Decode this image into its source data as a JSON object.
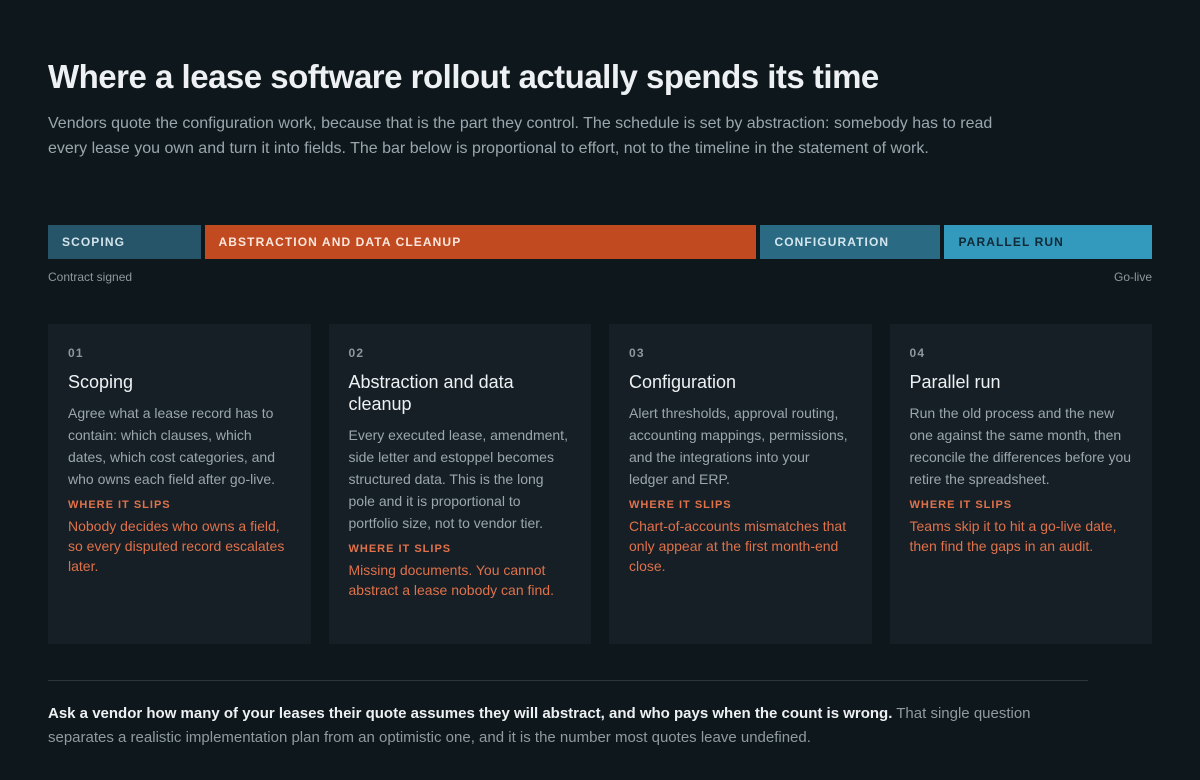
{
  "header": {
    "title": "Where a lease software rollout actually spends its time",
    "intro": "Vendors quote the configuration work, because that is the part they control. The schedule is set by abstraction: somebody has to read every lease you own and turn it into fields. The bar below is proportional to effort, not to the timeline in the statement of work."
  },
  "timeline": {
    "phases": [
      {
        "label": "SCOPING",
        "effort": 146,
        "bg": "#265468",
        "fg": "#d4e4ec"
      },
      {
        "label": "ABSTRACTION AND DATA CLEANUP",
        "effort": 567,
        "bg": "#c24a21",
        "fg": "#fbe7dd"
      },
      {
        "label": "CONFIGURATION",
        "effort": 175,
        "bg": "#2a6a82",
        "fg": "#d4e6ee"
      },
      {
        "label": "PARALLEL RUN",
        "effort": 204,
        "bg": "#3399bd",
        "fg": "#0f2a36"
      }
    ],
    "start_label": "Contract signed",
    "end_label": "Go-live"
  },
  "cards": [
    {
      "num": "01",
      "title": "Scoping",
      "body": "Agree what a lease record has to contain: which clauses, which dates, which cost categories, and who owns each field after go-live.",
      "slip_label": "WHERE IT SLIPS",
      "slip_text": "Nobody decides who owns a field, so every disputed record escalates later."
    },
    {
      "num": "02",
      "title": "Abstraction and data cleanup",
      "body": "Every executed lease, amendment, side letter and estoppel becomes structured data. This is the long pole and it is proportional to portfolio size, not to vendor tier.",
      "slip_label": "WHERE IT SLIPS",
      "slip_text": "Missing documents. You cannot abstract a lease nobody can find."
    },
    {
      "num": "03",
      "title": "Configuration",
      "body": "Alert thresholds, approval routing, accounting mappings, permissions, and the integrations into your ledger and ERP.",
      "slip_label": "WHERE IT SLIPS",
      "slip_text": "Chart-of-accounts mismatches that only appear at the first month-end close."
    },
    {
      "num": "04",
      "title": "Parallel run",
      "body": "Run the old process and the new one against the same month, then reconcile the differences before you retire the spreadsheet.",
      "slip_label": "WHERE IT SLIPS",
      "slip_text": "Teams skip it to hit a go-live date, then find the gaps in an audit."
    }
  ],
  "footer": {
    "lead": "Ask a vendor how many of your leases their quote assumes they will abstract, and who pays when the count is wrong.",
    "rest": " That single question separates a realistic implementation plan from an optimistic one, and it is the number most quotes leave undefined."
  }
}
